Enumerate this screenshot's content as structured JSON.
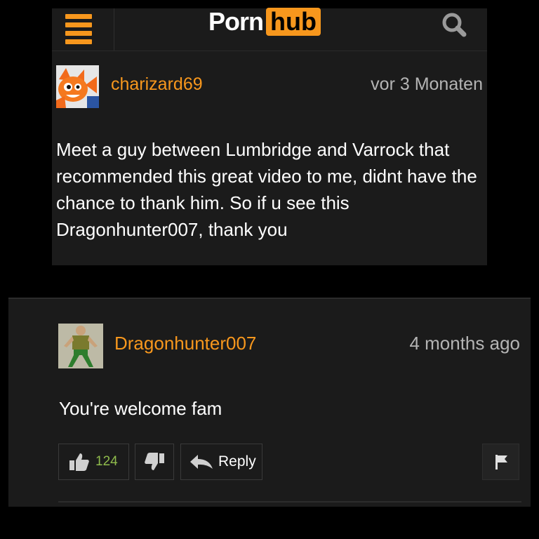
{
  "header": {
    "logo_text_left": "Porn",
    "logo_text_right": "hub",
    "icons": [
      "menu-icon",
      "search-icon"
    ]
  },
  "comment_1": {
    "username": "charizard69",
    "timestamp": "vor 3 Monaten",
    "text": "Meet a guy between Lumbridge and Varrock that recommended this great video to me, didnt have the chance to thank him. So if u see this Dragonhunter007, thank you"
  },
  "comment_2": {
    "username": "Dragonhunter007",
    "timestamp": "4 months ago",
    "text": "You're welcome fam",
    "likes": "124",
    "reply_label": "Reply",
    "icons": [
      "thumbs-up-icon",
      "thumbs-down-icon",
      "reply-arrow-icon",
      "flag-icon"
    ]
  },
  "colors": {
    "accent": "#f7971d",
    "background": "#1b1b1b",
    "page_background": "#000000",
    "timestamp": "#b4b4b4",
    "like_count": "#8fbb4c"
  }
}
